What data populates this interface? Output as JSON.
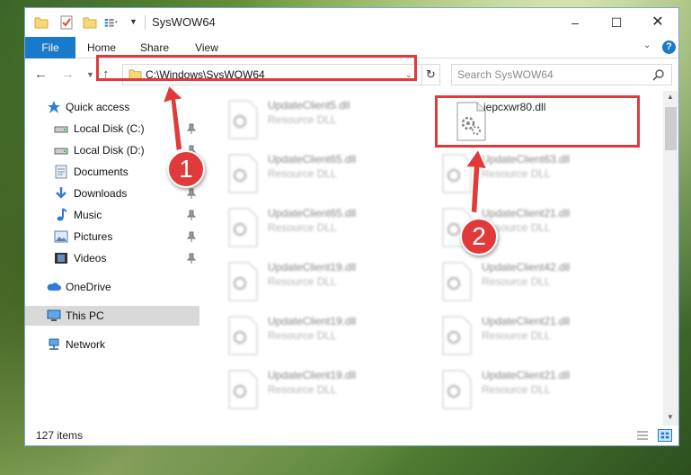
{
  "window": {
    "title": "SysWOW64",
    "quick_access_icons": [
      "folder-icon",
      "properties-icon",
      "new-folder-icon",
      "view-icon"
    ],
    "controls": {
      "minimize": "–",
      "maximize": "☐",
      "close": "✕"
    }
  },
  "ribbon": {
    "tabs": [
      {
        "label": "File"
      },
      {
        "label": "Home"
      },
      {
        "label": "Share"
      },
      {
        "label": "View"
      }
    ],
    "help": "?"
  },
  "nav": {
    "back": "←",
    "forward": "→",
    "up": "↑"
  },
  "address": {
    "path": "C:\\Windows\\SysWOW64"
  },
  "search": {
    "placeholder": "Search SysWOW64"
  },
  "sidebar": {
    "items": [
      {
        "label": "Quick access",
        "icon": "star-icon"
      },
      {
        "label": "Local Disk (C:)",
        "icon": "drive-icon",
        "pinned": true
      },
      {
        "label": "Local Disk (D:)",
        "icon": "drive-icon",
        "pinned": true
      },
      {
        "label": "Documents",
        "icon": "documents-icon",
        "pinned": true
      },
      {
        "label": "Downloads",
        "icon": "downloads-icon",
        "pinned": true
      },
      {
        "label": "Music",
        "icon": "music-icon",
        "pinned": true
      },
      {
        "label": "Pictures",
        "icon": "pictures-icon",
        "pinned": true
      },
      {
        "label": "Videos",
        "icon": "videos-icon",
        "pinned": true
      },
      {
        "label": "OneDrive",
        "icon": "cloud-icon"
      },
      {
        "label": "This PC",
        "icon": "computer-icon",
        "selected": true
      },
      {
        "label": "Network",
        "icon": "network-icon"
      }
    ]
  },
  "files": {
    "highlighted": {
      "name": "iepcxwr80.dll",
      "type": ""
    },
    "left_column": [
      {
        "name": "UpdateClient5.dll",
        "type": "Resource DLL"
      },
      {
        "name": "UpdateClient65.dll",
        "type": "Resource DLL"
      },
      {
        "name": "UpdateClient65.dll",
        "type": "Resource DLL"
      },
      {
        "name": "UpdateClient19.dll",
        "type": "Resource DLL"
      },
      {
        "name": "UpdateClient19.dll",
        "type": "Resource DLL"
      },
      {
        "name": "UpdateClient19.dll",
        "type": "Resource DLL"
      }
    ],
    "right_column": [
      {
        "name": "UpdateClient63.dll",
        "type": "Resource DLL"
      },
      {
        "name": "UpdateClient21.dll",
        "type": "Resource DLL"
      },
      {
        "name": "UpdateClient42.dll",
        "type": "Resource DLL"
      },
      {
        "name": "UpdateClient21.dll",
        "type": "Resource DLL"
      },
      {
        "name": "UpdateClient21.dll",
        "type": "Resource DLL"
      }
    ]
  },
  "status": {
    "item_count": "127 items"
  },
  "callouts": [
    "1",
    "2"
  ],
  "colors": {
    "accent": "#1979ca",
    "highlight_red": "#e03a3a",
    "selection_gray": "#d9d9d9"
  }
}
